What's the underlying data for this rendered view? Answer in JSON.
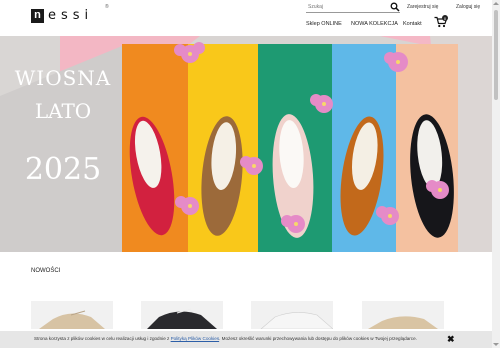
{
  "header": {
    "logo_letter": "n",
    "logo_rest": "essi",
    "logo_reg": "®",
    "search_placeholder": "Szukaj",
    "register_label": "Zarejestruj się",
    "login_label": "Zaloguj się",
    "nav": [
      {
        "label": "Sklep ONLINE"
      },
      {
        "label": "NOWA KOLEKCJA"
      },
      {
        "label": "Kontakt"
      }
    ],
    "cart_count": "0"
  },
  "hero": {
    "line1": "WIOSNA",
    "line2": "LATO",
    "year": "2025",
    "stripe_colors": [
      "#f08a1f",
      "#f9c81a",
      "#1e9a72",
      "#5fb8e8",
      "#f4c1a0"
    ]
  },
  "section": {
    "title": "NOWOŚCI"
  },
  "cookie": {
    "text_before": "Strona korzysta z plików cookies w celu realizacji usług i zgodnie z ",
    "link": "Polityką Plików Cookies",
    "text_after": ". Możesz określić warunki przechowywania lub dostępu do plików cookies w Twojej przeglądarce.",
    "close": "✖"
  }
}
